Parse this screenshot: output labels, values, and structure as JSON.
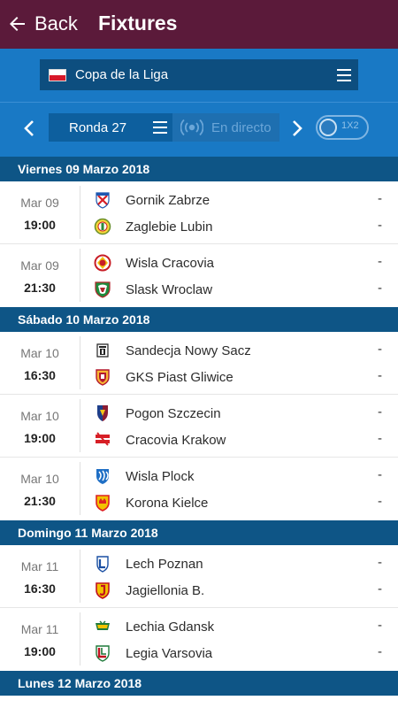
{
  "app": {
    "back_label": "Back",
    "title": "Fixtures"
  },
  "filters": {
    "competition": {
      "name": "Copa de la Liga",
      "flag": "poland-flag"
    },
    "round_label": "Ronda 27",
    "live_label": "En directo",
    "toggle_label": "1X2",
    "toggle_on": false
  },
  "colors": {
    "appbar": "#5b1a3a",
    "toolbar": "#1979c5",
    "day_header": "#0e5586"
  },
  "days": [
    {
      "label": "Viernes 09 Marzo 2018",
      "matches": [
        {
          "date": "Mar 09",
          "time": "19:00",
          "home": "Gornik Zabrze",
          "away": "Zaglebie Lubin",
          "home_score": "-",
          "away_score": "-",
          "home_crest": "gornik-zabrze-crest",
          "away_crest": "zaglebie-lubin-crest"
        },
        {
          "date": "Mar 09",
          "time": "21:30",
          "home": "Wisla Cracovia",
          "away": "Slask Wroclaw",
          "home_score": "-",
          "away_score": "-",
          "home_crest": "wisla-cracovia-crest",
          "away_crest": "slask-wroclaw-crest"
        }
      ]
    },
    {
      "label": "Sábado 10 Marzo 2018",
      "matches": [
        {
          "date": "Mar 10",
          "time": "16:30",
          "home": "Sandecja Nowy Sacz",
          "away": "GKS Piast Gliwice",
          "home_score": "-",
          "away_score": "-",
          "home_crest": "sandecja-crest",
          "away_crest": "piast-gliwice-crest"
        },
        {
          "date": "Mar 10",
          "time": "19:00",
          "home": "Pogon Szczecin",
          "away": "Cracovia Krakow",
          "home_score": "-",
          "away_score": "-",
          "home_crest": "pogon-szczecin-crest",
          "away_crest": "cracovia-krakow-crest"
        },
        {
          "date": "Mar 10",
          "time": "21:30",
          "home": "Wisla Plock",
          "away": "Korona Kielce",
          "home_score": "-",
          "away_score": "-",
          "home_crest": "wisla-plock-crest",
          "away_crest": "korona-kielce-crest"
        }
      ]
    },
    {
      "label": "Domingo 11 Marzo 2018",
      "matches": [
        {
          "date": "Mar 11",
          "time": "16:30",
          "home": "Lech Poznan",
          "away": "Jagiellonia B.",
          "home_score": "-",
          "away_score": "-",
          "home_crest": "lech-poznan-crest",
          "away_crest": "jagiellonia-crest"
        },
        {
          "date": "Mar 11",
          "time": "19:00",
          "home": "Lechia Gdansk",
          "away": "Legia Varsovia",
          "home_score": "-",
          "away_score": "-",
          "home_crest": "lechia-gdansk-crest",
          "away_crest": "legia-varsovia-crest"
        }
      ]
    },
    {
      "label": "Lunes 12 Marzo 2018",
      "matches": []
    }
  ]
}
